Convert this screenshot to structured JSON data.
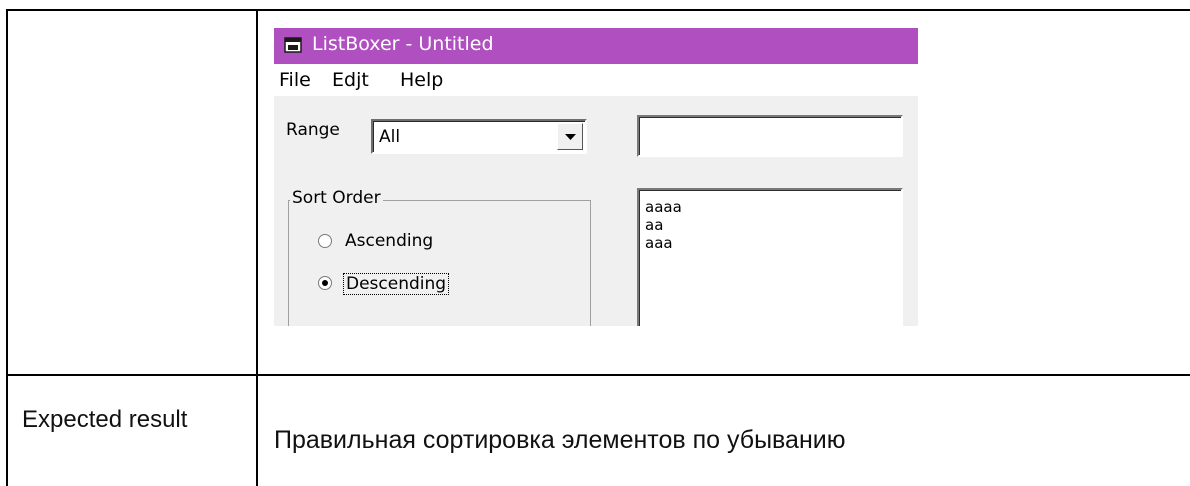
{
  "window": {
    "title": "ListBoxer - Untitled",
    "title_bar_color": "#b04fc0"
  },
  "menu": {
    "items": [
      "File",
      "Edjt",
      "Help"
    ]
  },
  "range": {
    "label": "Range",
    "selected": "All"
  },
  "text_field": {
    "value": ""
  },
  "sort_order": {
    "legend": "Sort Order",
    "options": [
      {
        "label": "Ascending",
        "checked": false
      },
      {
        "label": "Descending",
        "checked": true
      }
    ]
  },
  "listbox": {
    "items": [
      "aaaa",
      "aa",
      "aaa"
    ]
  },
  "table": {
    "row_label": "Expected result",
    "row_value": "Правильная сортировка элементов по убыванию"
  }
}
